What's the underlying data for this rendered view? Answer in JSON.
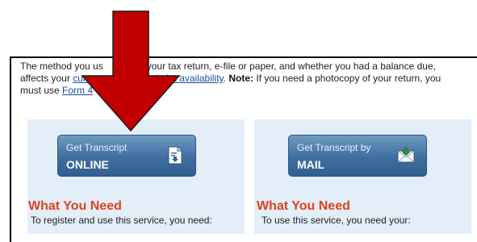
{
  "intro": {
    "line1_part1": "The method you us",
    "line1_part2": "e your tax return, e-file or paper, and whether you had a balance due,",
    "line2_prefix": "affects your ",
    "line2_link1": "current",
    "line2_link2": "nscript availability",
    "line2_period": ".",
    "note_label": "Note:",
    "line2_rest": " If you need a photocopy of your return, you",
    "line3_prefix": "must use ",
    "line3_link": "Form 4"
  },
  "left_panel": {
    "button_top": "Get Transcript",
    "button_main": "ONLINE",
    "button_icon": "document-download-icon",
    "heading": "What You Need",
    "subtext": "To register and use this service, you need:"
  },
  "right_panel": {
    "button_top": "Get Transcript by",
    "button_main": "MAIL",
    "button_icon": "envelope-download-icon",
    "heading": "What You Need",
    "subtext": "To use this service, you need your:"
  },
  "colors": {
    "arrow": "#c00000",
    "heading": "#e0431b",
    "button": "#3f6e9f",
    "panel": "#e3eef9",
    "link": "#1a4f9c"
  }
}
